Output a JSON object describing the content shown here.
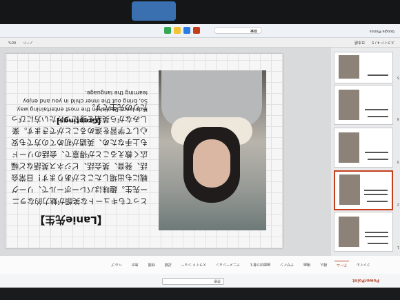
{
  "app": {
    "name": "PowerPoint",
    "search_placeholder": "検索"
  },
  "menus": [
    "ファイル",
    "ホーム",
    "挿入",
    "描画",
    "デザイン",
    "画面切り替え",
    "アニメーション",
    "スライド ショー",
    "記録",
    "校閲",
    "表示",
    "ヘルプ"
  ],
  "slide": {
    "title": "【Lanie先生】",
    "body": "とってもキュートな笑顔が魅力的なラニー先生。趣味はバレーボールで、リーグ戦にも出場したことがあります！日常会話、発音、英会話、ビジネス英語など幅広く教えることが得意で、会話のリードも上手なため、英語が初めての方でも安心して学習を進めることができます。楽しみながら英語を身につけたい方にぴったりの先生です。",
    "greeting_title": "【Greetings】",
    "greeting_text": "Kids learn English in the most entertaining way. So, bring out the inner child in you and enjoy learning the language."
  },
  "status": {
    "slide_info": "スライド 4 / 5",
    "language": "日本語",
    "notes": "ノート",
    "zoom": "60%"
  },
  "taskbar": {
    "search": "検索",
    "weather": "Google Photos"
  },
  "thumbnails": [
    {
      "num": "5",
      "title": "【Lanie先生】"
    },
    {
      "num": "4",
      "title": "【Lanie先生】"
    },
    {
      "num": "3",
      "title": "【Jake先生】"
    },
    {
      "num": "2",
      "title": "【Liane先生】"
    },
    {
      "num": "1",
      "title": "【Lanie先生】"
    }
  ],
  "colors": {
    "accent": "#c43e1c",
    "taskbar": "#eef1f6"
  }
}
